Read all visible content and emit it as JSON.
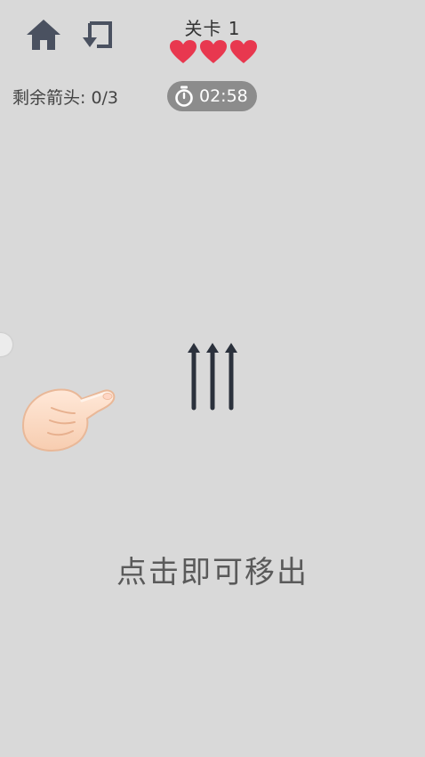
{
  "toolbar": {
    "home_icon": "home-icon",
    "undo_icon": "undo-return-icon"
  },
  "level": {
    "title": "关卡 1",
    "lives": 3,
    "heart_icon": "heart-icon",
    "heart_color": "#e8384f"
  },
  "status": {
    "arrows_remaining_label": "剩余箭头: 0/3",
    "timer_icon": "stopwatch-icon",
    "timer_value": "02:58",
    "timer_bg": "#8c8c8c"
  },
  "board": {
    "arrow_count": 3,
    "arrow_direction": "up",
    "arrow_color": "#2b313c"
  },
  "tutorial": {
    "pointer_icon": "pointing-hand-icon",
    "hint": "点击即可移出"
  }
}
